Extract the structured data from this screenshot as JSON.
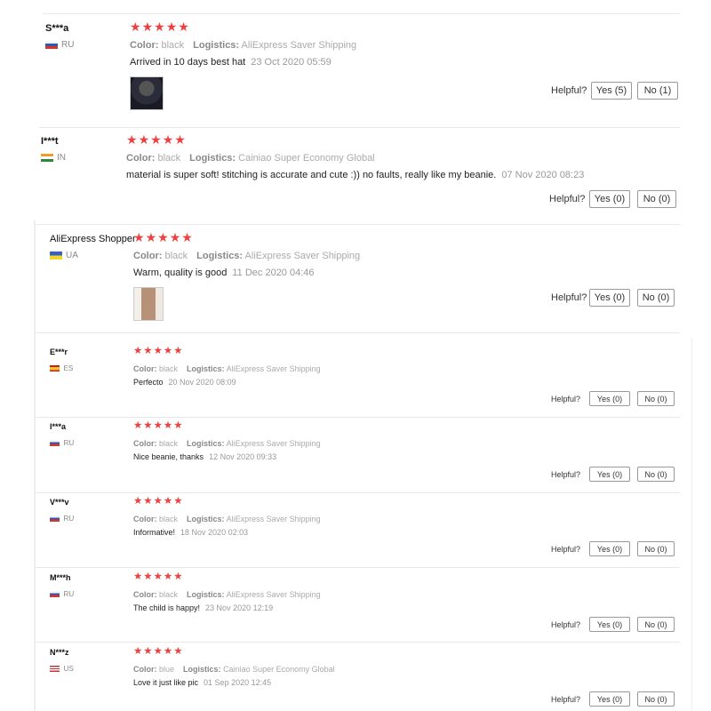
{
  "helpful_label": "Helpful?",
  "attr_color_key": "Color:",
  "attr_logistics_key": "Logistics:",
  "star_glyph": "★",
  "star_color": "#ee4040",
  "reviews": [
    {
      "name": "S***a",
      "country": "RU",
      "rating": 5,
      "color": "black",
      "logistics": "AliExpress Saver Shipping",
      "text": "Arrived in 10 days best hat",
      "date": "23 Oct 2020 05:59",
      "has_photo": true,
      "yes": "Yes (5)",
      "no": "No (1)"
    },
    {
      "name": "I***t",
      "country": "IN",
      "rating": 5,
      "color": "black",
      "logistics": "Cainiao Super Economy Global",
      "text": "material is super soft! stitching is accurate and cute :)) no faults, really like my beanie.",
      "date": "07 Nov 2020 08:23",
      "has_photo": false,
      "yes": "Yes (0)",
      "no": "No (0)"
    },
    {
      "name": "AliExpress Shopper",
      "country": "UA",
      "rating": 5,
      "color": "black",
      "logistics": "AliExpress Saver Shipping",
      "text": "Warm, quality is good",
      "date": "11 Dec 2020 04:46",
      "has_photo": true,
      "yes": "Yes (0)",
      "no": "No (0)"
    },
    {
      "name": "E***r",
      "country": "ES",
      "rating": 5,
      "color": "black",
      "logistics": "AliExpress Saver Shipping",
      "text": "Perfecto",
      "date": "20 Nov 2020 08:09",
      "has_photo": false,
      "yes": "Yes (0)",
      "no": "No (0)"
    },
    {
      "name": "I***a",
      "country": "RU",
      "rating": 5,
      "color": "black",
      "logistics": "AliExpress Saver Shipping",
      "text": "Nice beanie, thanks",
      "date": "12 Nov 2020 09:33",
      "has_photo": false,
      "yes": "Yes (0)",
      "no": "No (0)"
    },
    {
      "name": "V***v",
      "country": "RU",
      "rating": 5,
      "color": "black",
      "logistics": "AliExpress Saver Shipping",
      "text": "Informative!",
      "date": "18 Nov 2020 02:03",
      "has_photo": false,
      "yes": "Yes (0)",
      "no": "No (0)"
    },
    {
      "name": "M***h",
      "country": "RU",
      "rating": 5,
      "color": "black",
      "logistics": "AliExpress Saver Shipping",
      "text": "The child is happy!",
      "date": "23 Nov 2020 12:19",
      "has_photo": false,
      "yes": "Yes (0)",
      "no": "No (0)"
    },
    {
      "name": "N***z",
      "country": "US",
      "rating": 5,
      "color": "blue",
      "logistics": "Cainiao Super Economy Global",
      "text": "Love it just like pic",
      "date": "01 Sep 2020 12:45",
      "has_photo": false,
      "yes": "Yes (0)",
      "no": "No (0)"
    }
  ]
}
